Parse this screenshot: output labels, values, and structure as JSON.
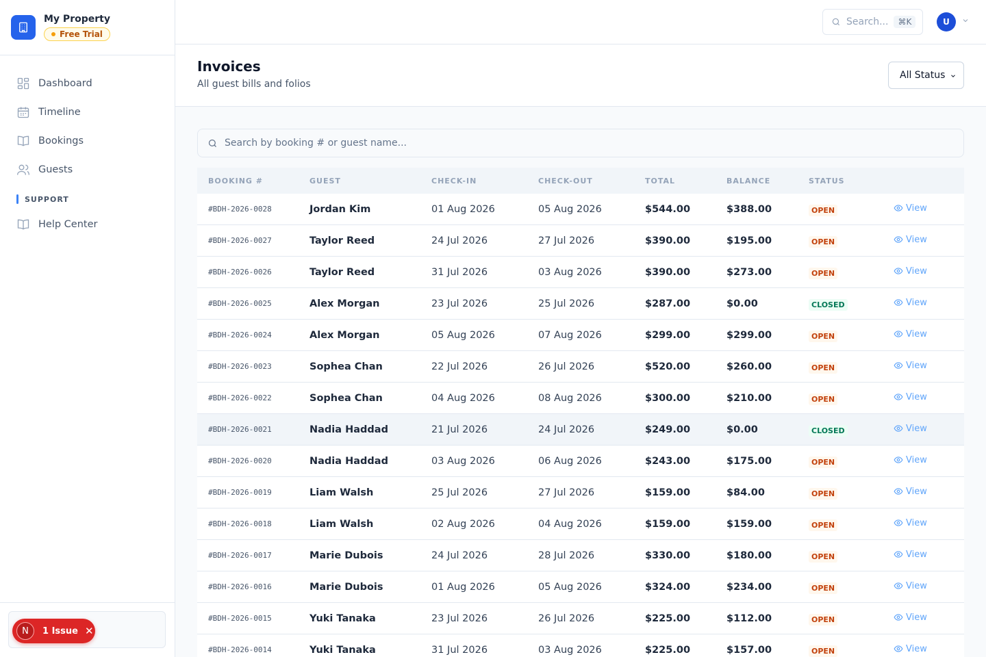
{
  "brand": {
    "name": "My Property",
    "trial_label": "Free Trial"
  },
  "nav": {
    "items": [
      {
        "label": "Dashboard",
        "icon": "grid-icon"
      },
      {
        "label": "Timeline",
        "icon": "calendar-icon"
      },
      {
        "label": "Bookings",
        "icon": "book-icon"
      },
      {
        "label": "Guests",
        "icon": "users-icon"
      }
    ],
    "support_heading": "SUPPORT",
    "support_items": [
      {
        "label": "Help Center",
        "icon": "book-icon"
      }
    ]
  },
  "issue_badge": {
    "avatar_letter": "N",
    "label": "1 Issue"
  },
  "topbar": {
    "search_placeholder": "Search...",
    "shortcut": "⌘K",
    "avatar_initial": "U"
  },
  "page": {
    "title": "Invoices",
    "subtitle": "All guest bills and folios",
    "status_filter": "All Status"
  },
  "table": {
    "search_placeholder": "Search by booking # or guest name...",
    "columns": [
      "BOOKING #",
      "GUEST",
      "CHECK-IN",
      "CHECK-OUT",
      "TOTAL",
      "BALANCE",
      "STATUS"
    ],
    "view_label": "View",
    "rows": [
      {
        "booking": "#BDH-2026-0028",
        "guest": "Jordan Kim",
        "check_in": "01 Aug 2026",
        "check_out": "05 Aug 2026",
        "total": "$544.00",
        "balance": "$388.00",
        "status": "OPEN"
      },
      {
        "booking": "#BDH-2026-0027",
        "guest": "Taylor Reed",
        "check_in": "24 Jul 2026",
        "check_out": "27 Jul 2026",
        "total": "$390.00",
        "balance": "$195.00",
        "status": "OPEN"
      },
      {
        "booking": "#BDH-2026-0026",
        "guest": "Taylor Reed",
        "check_in": "31 Jul 2026",
        "check_out": "03 Aug 2026",
        "total": "$390.00",
        "balance": "$273.00",
        "status": "OPEN"
      },
      {
        "booking": "#BDH-2026-0025",
        "guest": "Alex Morgan",
        "check_in": "23 Jul 2026",
        "check_out": "25 Jul 2026",
        "total": "$287.00",
        "balance": "$0.00",
        "status": "CLOSED"
      },
      {
        "booking": "#BDH-2026-0024",
        "guest": "Alex Morgan",
        "check_in": "05 Aug 2026",
        "check_out": "07 Aug 2026",
        "total": "$299.00",
        "balance": "$299.00",
        "status": "OPEN"
      },
      {
        "booking": "#BDH-2026-0023",
        "guest": "Sophea Chan",
        "check_in": "22 Jul 2026",
        "check_out": "26 Jul 2026",
        "total": "$520.00",
        "balance": "$260.00",
        "status": "OPEN"
      },
      {
        "booking": "#BDH-2026-0022",
        "guest": "Sophea Chan",
        "check_in": "04 Aug 2026",
        "check_out": "08 Aug 2026",
        "total": "$300.00",
        "balance": "$210.00",
        "status": "OPEN"
      },
      {
        "booking": "#BDH-2026-0021",
        "guest": "Nadia Haddad",
        "check_in": "21 Jul 2026",
        "check_out": "24 Jul 2026",
        "total": "$249.00",
        "balance": "$0.00",
        "status": "CLOSED"
      },
      {
        "booking": "#BDH-2026-0020",
        "guest": "Nadia Haddad",
        "check_in": "03 Aug 2026",
        "check_out": "06 Aug 2026",
        "total": "$243.00",
        "balance": "$175.00",
        "status": "OPEN"
      },
      {
        "booking": "#BDH-2026-0019",
        "guest": "Liam Walsh",
        "check_in": "25 Jul 2026",
        "check_out": "27 Jul 2026",
        "total": "$159.00",
        "balance": "$84.00",
        "status": "OPEN"
      },
      {
        "booking": "#BDH-2026-0018",
        "guest": "Liam Walsh",
        "check_in": "02 Aug 2026",
        "check_out": "04 Aug 2026",
        "total": "$159.00",
        "balance": "$159.00",
        "status": "OPEN"
      },
      {
        "booking": "#BDH-2026-0017",
        "guest": "Marie Dubois",
        "check_in": "24 Jul 2026",
        "check_out": "28 Jul 2026",
        "total": "$330.00",
        "balance": "$180.00",
        "status": "OPEN"
      },
      {
        "booking": "#BDH-2026-0016",
        "guest": "Marie Dubois",
        "check_in": "01 Aug 2026",
        "check_out": "05 Aug 2026",
        "total": "$324.00",
        "balance": "$234.00",
        "status": "OPEN"
      },
      {
        "booking": "#BDH-2026-0015",
        "guest": "Yuki Tanaka",
        "check_in": "23 Jul 2026",
        "check_out": "26 Jul 2026",
        "total": "$225.00",
        "balance": "$112.00",
        "status": "OPEN"
      },
      {
        "booking": "#BDH-2026-0014",
        "guest": "Yuki Tanaka",
        "check_in": "31 Jul 2026",
        "check_out": "03 Aug 2026",
        "total": "$225.00",
        "balance": "$157.00",
        "status": "OPEN"
      }
    ]
  }
}
